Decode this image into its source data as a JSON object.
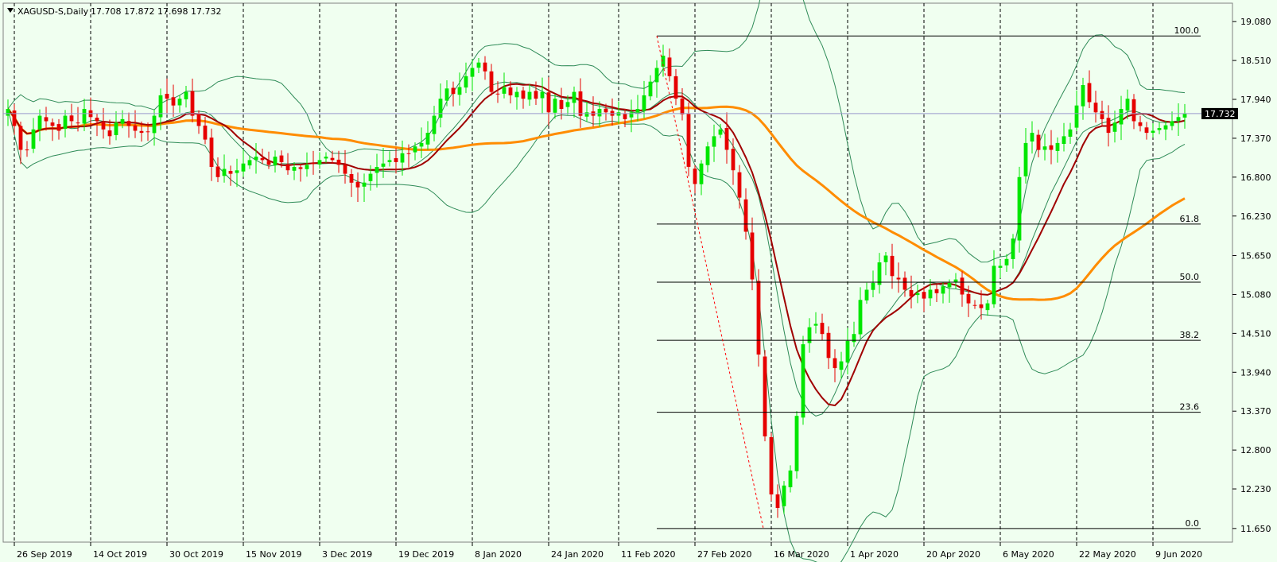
{
  "chart_data": {
    "type": "candlestick",
    "symbol": "XAGUSD-S,Daily",
    "ohlc_readout": "17.708 17.872 17.698 17.732",
    "current_price": "17.732",
    "ylim": [
      11.45,
      19.35
    ],
    "y_ticks": [
      "19.080",
      "18.510",
      "17.940",
      "17.370",
      "16.800",
      "16.230",
      "15.650",
      "15.080",
      "14.510",
      "13.940",
      "13.370",
      "12.800",
      "12.230",
      "11.650"
    ],
    "x_labels": [
      "26 Sep 2019",
      "14 Oct 2019",
      "30 Oct 2019",
      "15 Nov 2019",
      "3 Dec 2019",
      "19 Dec 2019",
      "8 Jan 2020",
      "24 Jan 2020",
      "11 Feb 2020",
      "27 Feb 2020",
      "16 Mar 2020",
      "1 Apr 2020",
      "20 Apr 2020",
      "6 May 2020",
      "22 May 2020",
      "9 Jun 2020"
    ],
    "fibonacci": {
      "high": 18.87,
      "low": 11.65,
      "levels": [
        {
          "label": "100.0",
          "ratio": 1.0
        },
        {
          "label": "61.8",
          "ratio": 0.618
        },
        {
          "label": "50.0",
          "ratio": 0.5
        },
        {
          "label": "38.2",
          "ratio": 0.382
        },
        {
          "label": "23.6",
          "ratio": 0.236
        },
        {
          "label": "0.0",
          "ratio": 0.0
        }
      ]
    },
    "closes": [
      17.8,
      17.55,
      17.2,
      17.2,
      17.5,
      17.7,
      17.62,
      17.55,
      17.48,
      17.7,
      17.62,
      17.6,
      17.8,
      17.68,
      17.62,
      17.5,
      17.4,
      17.6,
      17.65,
      17.55,
      17.48,
      17.45,
      17.46,
      17.7,
      18.0,
      17.95,
      17.85,
      17.95,
      18.05,
      17.7,
      17.55,
      17.35,
      16.95,
      16.8,
      16.92,
      16.85,
      16.9,
      17.0,
      17.05,
      17.1,
      17.05,
      16.98,
      17.1,
      17.02,
      16.9,
      16.95,
      16.92,
      16.98,
      17.0,
      17.05,
      17.1,
      17.05,
      16.98,
      16.85,
      16.72,
      16.65,
      16.72,
      16.85,
      16.95,
      17.0,
      17.05,
      17.02,
      17.15,
      17.15,
      17.25,
      17.3,
      17.45,
      17.7,
      17.95,
      18.1,
      18.02,
      18.12,
      18.28,
      18.4,
      18.48,
      18.35,
      18.05,
      18.02,
      18.12,
      18.0,
      18.05,
      17.95,
      18.05,
      17.95,
      18.05,
      17.75,
      17.95,
      17.8,
      17.9,
      18.05,
      17.7,
      17.75,
      17.7,
      17.8,
      17.75,
      17.7,
      17.75,
      17.65,
      17.75,
      17.8,
      18.0,
      18.2,
      18.4,
      18.58,
      18.28,
      17.95,
      17.72,
      16.95,
      16.7,
      17.0,
      17.25,
      17.4,
      17.5,
      17.2,
      16.9,
      16.5,
      16.0,
      15.3,
      14.2,
      13.0,
      12.15,
      11.95,
      12.28,
      12.5,
      13.3,
      14.35,
      14.6,
      14.65,
      14.5,
      14.15,
      14.0,
      14.1,
      14.4,
      14.5,
      15.0,
      15.15,
      15.25,
      15.55,
      15.65,
      15.35,
      15.3,
      15.15,
      15.05,
      15.1,
      15.02,
      15.15,
      15.1,
      15.2,
      15.25,
      15.3,
      15.08,
      14.95,
      14.92,
      14.88,
      14.95,
      15.5,
      15.5,
      15.6,
      15.9,
      16.8,
      17.3,
      17.45,
      17.2,
      17.25,
      17.2,
      17.3,
      17.4,
      17.5,
      17.85,
      18.15,
      17.9,
      17.75,
      17.65,
      17.45,
      17.6,
      17.8,
      17.95,
      17.62,
      17.55,
      17.45,
      17.48,
      17.52,
      17.56,
      17.62,
      17.68,
      17.732
    ]
  }
}
